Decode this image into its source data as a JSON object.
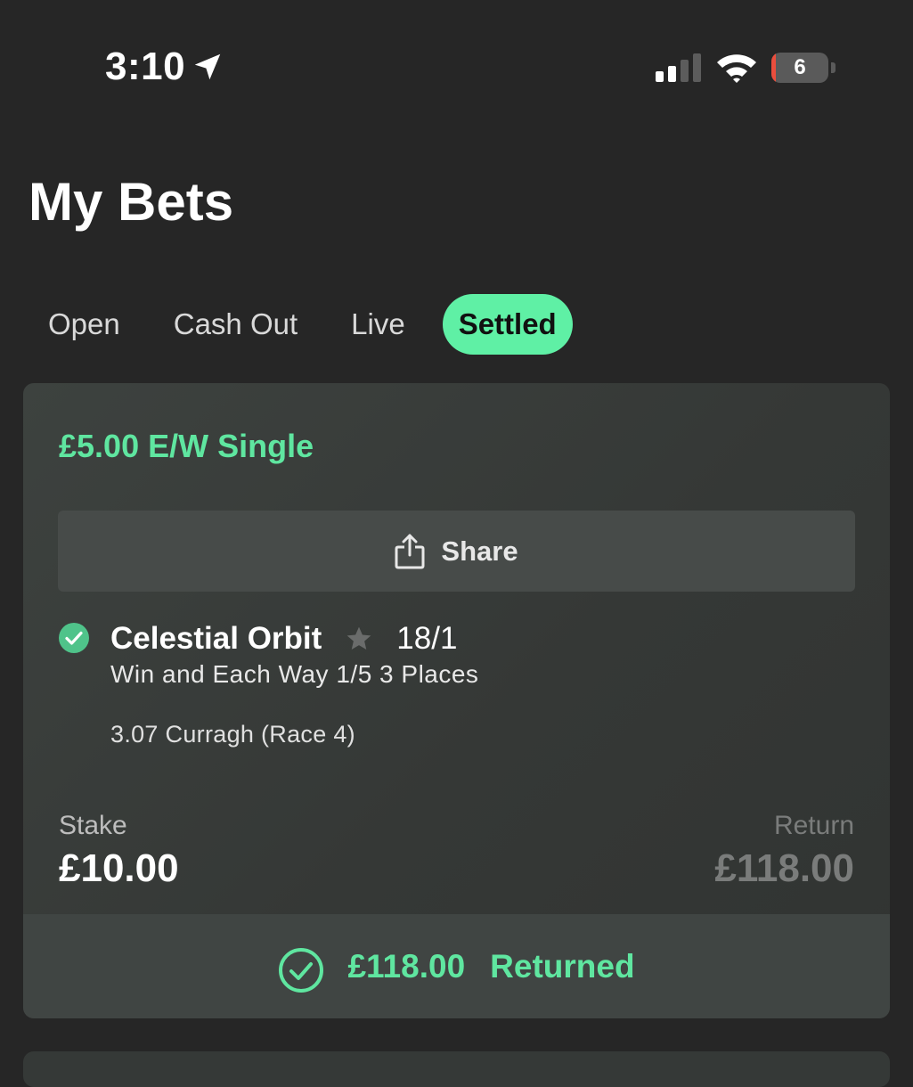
{
  "status_bar": {
    "time": "3:10",
    "battery_level": "6",
    "battery_fraction": 0.06,
    "signal_bars": 2,
    "icons": [
      "location-arrow-icon",
      "cellular-signal-icon",
      "wifi-icon",
      "battery-icon"
    ]
  },
  "header": {
    "title": "My Bets"
  },
  "tabs": [
    {
      "label": "Open",
      "active": false
    },
    {
      "label": "Cash Out",
      "active": false
    },
    {
      "label": "Live",
      "active": false
    },
    {
      "label": "Settled",
      "active": true
    }
  ],
  "bet": {
    "type": "£5.00 E/W Single",
    "share_label": "Share",
    "selection": {
      "name": "Celestial Orbit",
      "odds": "18/1",
      "market": "Win and Each Way 1/5 3 Places",
      "event": "3.07 Curragh (Race 4)",
      "status_icon": "check-circle-icon",
      "favourite_icon": "star-icon"
    },
    "stake_label": "Stake",
    "stake_value": "£10.00",
    "return_label": "Return",
    "return_value": "£118.00",
    "returned_amount": "£118.00",
    "returned_label": "Returned"
  },
  "colors": {
    "background": "#262626",
    "accent": "#5ff0a5",
    "accent_text": "#5fe6a0",
    "card": "#383b39",
    "muted": "#7a7c7b"
  }
}
